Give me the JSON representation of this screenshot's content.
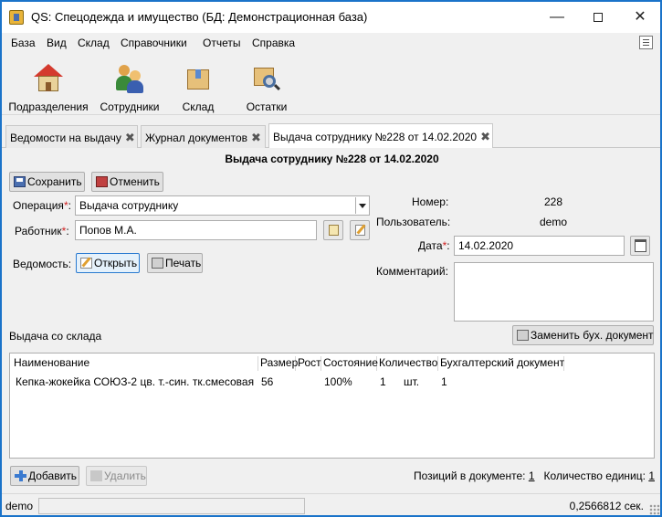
{
  "window": {
    "title": "QS: Спецодежда и имущество (БД: Демонстрационная база)",
    "controls": {
      "minimize": "—",
      "maximize": "",
      "close": "✕"
    }
  },
  "menu": [
    "База",
    "Вид",
    "Склад",
    "Справочники",
    "Отчеты",
    "Справка"
  ],
  "toolbar": {
    "departments": "Подразделения",
    "employees": "Сотрудники",
    "warehouse": "Склад",
    "stock": "Остатки"
  },
  "tabs": [
    {
      "label": "Ведомости на выдачу",
      "active": false
    },
    {
      "label": "Журнал документов",
      "active": false
    },
    {
      "label": "Выдача сотруднику №228 от 14.02.2020",
      "active": true
    }
  ],
  "document": {
    "heading": "Выдача сотруднику №228 от 14.02.2020",
    "save_label": "Сохранить",
    "cancel_label": "Отменить",
    "operation_label": "Операция",
    "operation_value": "Выдача сотруднику",
    "worker_label": "Работник",
    "worker_value": "Попов М.А.",
    "statement_label": "Ведомость:",
    "open_label": "Открыть",
    "print_label": "Печать",
    "required_mark": "*",
    "colon": ":",
    "number_label": "Номер:",
    "number_value": "228",
    "user_label": "Пользователь:",
    "user_value": "demo",
    "date_label": "Дата",
    "date_value": "14.02.2020",
    "comment_label": "Комментарий:",
    "comment_value": ""
  },
  "items_section": {
    "title": "Выдача со склада",
    "replace_button": "Заменить бух. документ",
    "columns": [
      "Наименование",
      "Размер",
      "Рост",
      "Состояние",
      "Количество",
      "Бухгалтерский документ"
    ],
    "rows": [
      {
        "name": "Кепка-жокейка СОЮЗ-2 цв. т.-син. тк.смесовая",
        "size": "56",
        "height": "",
        "condition": "100%",
        "quantity": "1",
        "unit": "шт.",
        "accounting_doc": "1"
      }
    ],
    "add_label": "Добавить",
    "delete_label": "Удалить",
    "positions_label": "Позиций в документе:",
    "positions_value": "1",
    "units_label": "Количество единиц:",
    "units_value": "1"
  },
  "status_bar": {
    "user": "demo",
    "time": "0,2566812 сек."
  },
  "colors": {
    "window_border": "#1a73c9",
    "required": "#d02020",
    "focus": "#2a7ad0"
  }
}
